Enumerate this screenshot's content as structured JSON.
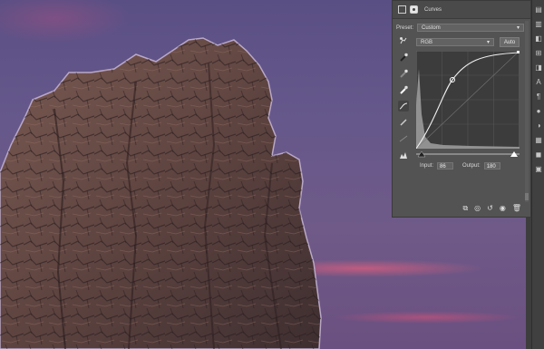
{
  "panel": {
    "title": "Curves",
    "preset_label": "Preset:",
    "preset_value": "Custom",
    "channel_value": "RGB",
    "auto_label": "Auto",
    "input_label": "Input:",
    "input_value": "86",
    "output_label": "Output:",
    "output_value": "180"
  },
  "tools": [
    "target-adjust-icon",
    "black-point-eyedropper-icon",
    "gray-point-eyedropper-icon",
    "white-point-eyedropper-icon",
    "curve-points-icon",
    "pencil-icon",
    "smooth-icon",
    "clipping-warning-icon"
  ],
  "footer_icons": [
    "clip-to-layer-icon",
    "view-previous-icon",
    "reset-icon",
    "visibility-eye-icon",
    "delete-icon"
  ],
  "toolbar_icons": [
    "toolbar-icon",
    "toolbar-icon",
    "toolbar-icon",
    "text-icon",
    "toolbar-icon",
    "toolbar-icon",
    "toolbar-icon",
    "toolbar-icon",
    "toolbar-icon",
    "toolbar-icon",
    "toolbar-icon",
    "toolbar-icon"
  ]
}
